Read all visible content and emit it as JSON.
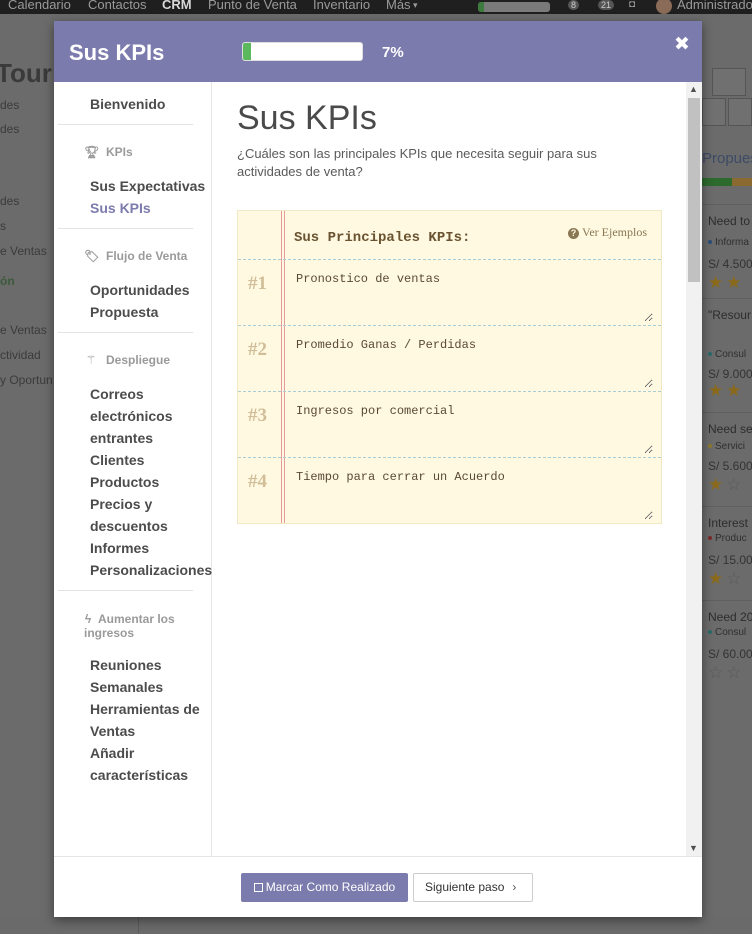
{
  "background": {
    "topbar": {
      "menu": [
        "Calendario",
        "Contactos",
        "CRM",
        "Punto de Venta",
        "Inventario",
        "Más"
      ],
      "active_menu": "CRM",
      "notif_count_1": "8",
      "notif_count_2": "21",
      "user": "Administrador"
    },
    "left": {
      "title": "Tour I",
      "items": [
        "des",
        "des",
        "des",
        "s",
        "e Ventas",
        "ón",
        "e Ventas",
        "ctividad",
        "y Oportun"
      ]
    },
    "right": {
      "stage": "Propues",
      "cards": [
        {
          "title": "Need to",
          "tag": "Informa",
          "amount": "S/ 4.500"
        },
        {
          "title": "\"Resour develpm",
          "tag": "Consul",
          "amount": "S/ 9.000"
        },
        {
          "title": "Need se",
          "tag": "Servici",
          "amount": "S/ 5.600"
        },
        {
          "title": "Interest",
          "tag": "Produc",
          "amount": "S/ 15.00"
        },
        {
          "title": "Need 20",
          "tag": "Consul",
          "amount": "S/ 60.00"
        }
      ]
    }
  },
  "modal": {
    "title": "Sus KPIs",
    "progress": 0.07,
    "progress_label": "7%",
    "close_glyph": "✖",
    "sidebar": {
      "welcome": "Bienvenido",
      "sections": [
        {
          "icon": "trophy-icon",
          "label": "KPIs",
          "items": [
            "Sus Expectativas",
            "Sus KPIs"
          ]
        },
        {
          "icon": "tag-icon",
          "label": "Flujo de Venta",
          "items": [
            "Oportunidades",
            "Propuesta"
          ]
        },
        {
          "icon": "magic-wand-icon",
          "label": "Despliegue",
          "items": [
            "Correos electrónicos entrantes",
            "Clientes",
            "Productos",
            "Precios y descuentos",
            "Informes",
            "Personalizaciones"
          ]
        },
        {
          "icon": "bolt-icon",
          "label": "Aumentar los ingresos",
          "items": [
            "Reuniones Semanales",
            "Herramientas de Ventas",
            "Añadir características"
          ]
        }
      ],
      "active_item": "Sus KPIs"
    },
    "content": {
      "heading": "Sus KPIs",
      "subtitle": "¿Cuáles son las principales KPIs que necesita seguir para sus actividades de venta?",
      "paper_header": "Sus Principales KPIs:",
      "examples_link": "Ver Ejemplos",
      "kpis": [
        {
          "number": "#1",
          "value": "Pronostico de ventas"
        },
        {
          "number": "#2",
          "value": "Promedio Ganas / Perdidas"
        },
        {
          "number": "#3",
          "value": "Ingresos por comercial"
        },
        {
          "number": "#4",
          "value": "Tiempo para cerrar un Acuerdo"
        }
      ]
    },
    "footer": {
      "done_label": "Marcar Como Realizado",
      "next_label": "Siguiente paso"
    }
  },
  "colors": {
    "accent": "#7c7bad",
    "progress_fill": "#5cb85c",
    "paper": "#fff9e2"
  }
}
